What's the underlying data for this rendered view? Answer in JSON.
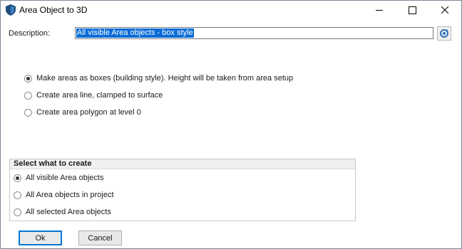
{
  "window": {
    "title": "Area Object to 3D",
    "minimize_icon": "minimize-icon",
    "maximize_icon": "maximize-icon",
    "close_icon": "close-icon"
  },
  "description": {
    "label": "Description:",
    "value": "All visible Area objects - box style",
    "refresh_icon": "refresh-icon"
  },
  "style_options": {
    "items": [
      {
        "label": "Make areas as boxes (building style). Height will be taken from area setup",
        "checked": true
      },
      {
        "label": "Create area line, clamped to surface",
        "checked": false
      },
      {
        "label": "Create area polygon at level 0",
        "checked": false
      }
    ]
  },
  "selection_group": {
    "header": "Select what to create",
    "items": [
      {
        "label": "All visible Area objects",
        "checked": true
      },
      {
        "label": "All Area objects in project",
        "checked": false
      },
      {
        "label": "All selected Area objects",
        "checked": false
      }
    ]
  },
  "buttons": {
    "ok": "Ok",
    "cancel": "Cancel"
  },
  "colors": {
    "selection": "#0a6cd6",
    "default_button_border": "#0078d7"
  }
}
